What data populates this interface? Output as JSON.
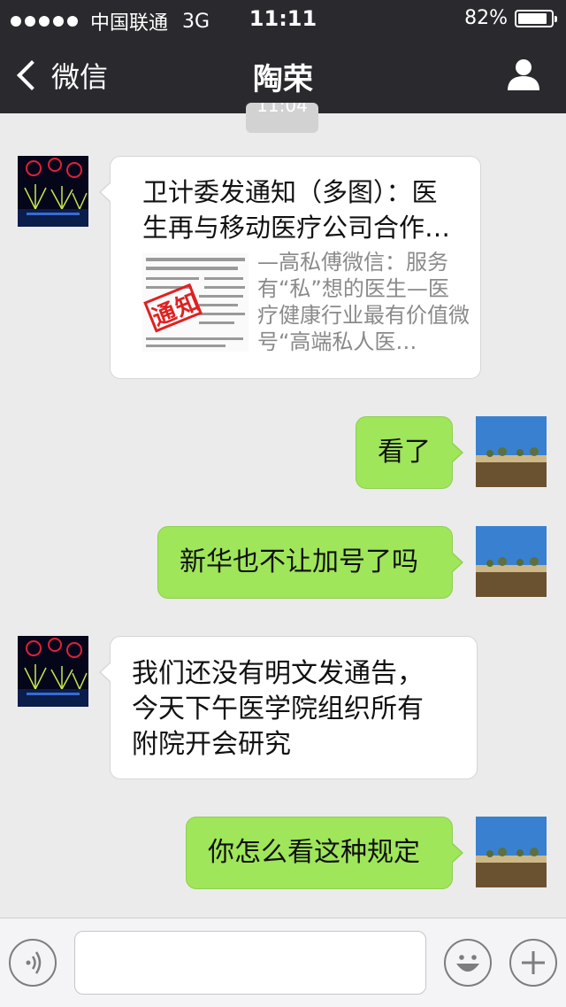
{
  "status_bar": {
    "carrier": "中国联通",
    "network": "3G",
    "time": "11:11",
    "battery": "82%"
  },
  "nav": {
    "back_label": "微信",
    "title": "陶荣"
  },
  "timestamp": "11:04",
  "messages": [
    {
      "type": "article",
      "side": "incoming",
      "title": "卫计委发通知（多图）：医生再与移动医疗公司合作…",
      "description": "—高私傅微信：服务有“私”想的医生—医疗健康行业最有价值微号“高端私人医…",
      "thumbnail_text": "通知"
    },
    {
      "type": "text",
      "side": "outgoing",
      "text": "看了"
    },
    {
      "type": "text",
      "side": "outgoing",
      "text": "新华也不让加号了吗"
    },
    {
      "type": "text",
      "side": "incoming",
      "text": "我们还没有明文发通告，\n今天下午医学院组织所有\n附院开会研究"
    },
    {
      "type": "text",
      "side": "outgoing",
      "text": "你怎么看这种规定"
    }
  ],
  "input_bar": {
    "input_value": "",
    "icons": [
      "voice-icon",
      "emoji-icon",
      "plus-icon"
    ]
  },
  "colors": {
    "header_bg": "#2a2a2e",
    "chat_bg": "#ebebeb",
    "outgoing_bubble": "#9fe65a",
    "incoming_bubble": "#ffffff",
    "stamp_red": "#e02020"
  }
}
